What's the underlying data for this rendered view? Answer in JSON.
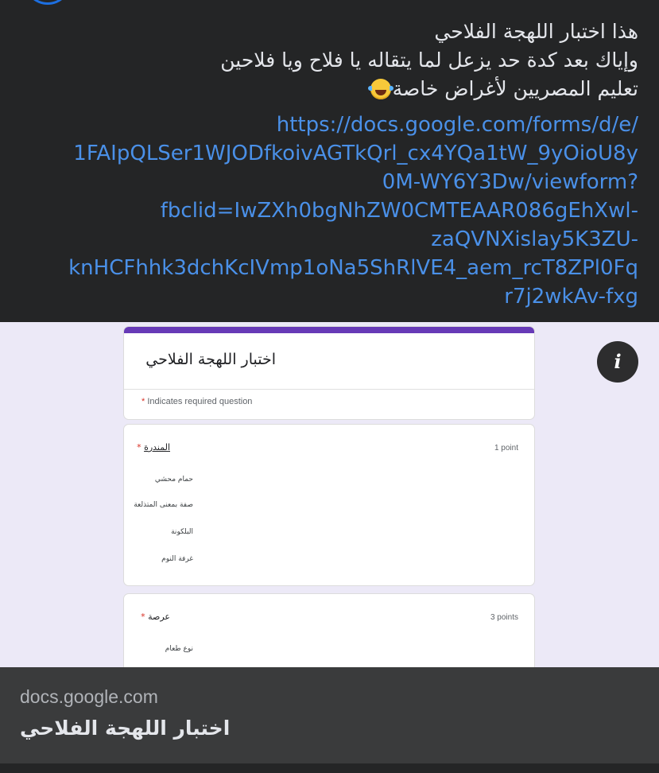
{
  "post": {
    "text_lines": [
      "هذا اختبار اللهجة الفلاحي",
      "وإياك بعد كدة حد يزعل لما يتقاله يا فلاح ويا فلاحين",
      "تعليم المصريين لأغراض خاصة"
    ],
    "emoji": "tears-of-joy-emoji",
    "link_lines": [
      "https://docs.google.com/forms/d/e/",
      "1FAIpQLSer1WJODfkoivAGTkQrl_cx4YQa1tW_9yOioU8y",
      "0M-WY6Y3Dw/viewform?",
      "fbclid=IwZXh0bgNhZW0CMTEAAR086gEhXwl-",
      "zaQVNXislay5K3ZU-",
      "knHCFhhk3dchKcIVmp1oNa5ShRlVE4_aem_rcT8ZPl0Fq",
      "r7j2wkAv-fxg"
    ]
  },
  "form_preview": {
    "title": "اختبار اللهجة الفلاحي",
    "required_star": "*",
    "required_note": "Indicates required question",
    "questions": [
      {
        "title": "المندرة",
        "star": "*",
        "points": "1 point",
        "options": [
          "حمام محشي",
          "صفة بمعنى المتذلعة",
          "البلكونة",
          "غرفة النوم"
        ]
      },
      {
        "title": "عرصة",
        "star": "*",
        "points": "3 points",
        "options": [
          "نوع طعام"
        ]
      }
    ],
    "info_icon": "info-icon",
    "info_glyph": "i"
  },
  "link_card": {
    "domain": "docs.google.com",
    "title": "اختبار اللهجة الفلاحي"
  },
  "colors": {
    "background": "#242526",
    "link": "#4a90e8",
    "form_accent": "#673ab7",
    "preview_bg": "#ece9f7",
    "footer_bg": "#3a3b3c"
  }
}
